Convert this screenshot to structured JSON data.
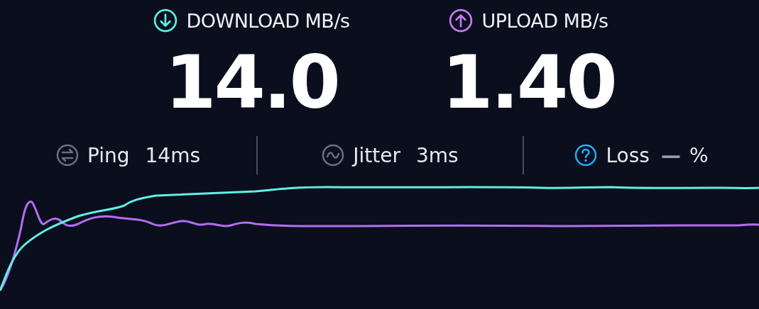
{
  "speeds": [
    {
      "kind": "download",
      "label": "DOWNLOAD MB/s",
      "value": "14.0"
    },
    {
      "kind": "upload",
      "label": "UPLOAD MB/s",
      "value": "1.40"
    }
  ],
  "metrics": [
    {
      "kind": "ping",
      "label": "Ping",
      "value": "14ms"
    },
    {
      "kind": "jitter",
      "label": "Jitter",
      "value": "3ms"
    },
    {
      "kind": "loss",
      "label": "Loss",
      "value": "—",
      "unit": "%"
    }
  ]
}
